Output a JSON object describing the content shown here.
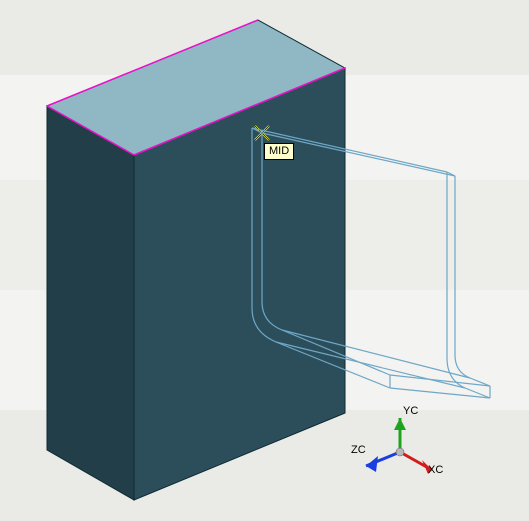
{
  "snap": {
    "label": "MID"
  },
  "triad": {
    "x_label": "XC",
    "y_label": "YC",
    "z_label": "ZC"
  },
  "colors": {
    "face_top": "#8fb7c4",
    "face_front": "#2b4e5a",
    "face_side": "#1e3a44",
    "edge_highlight": "#e812c9",
    "wire": "#6fa7c7",
    "axis_x": "#d31b1b",
    "axis_y": "#1fa31f",
    "axis_z": "#1a3fe0",
    "snap_marker": "#fffd38"
  }
}
